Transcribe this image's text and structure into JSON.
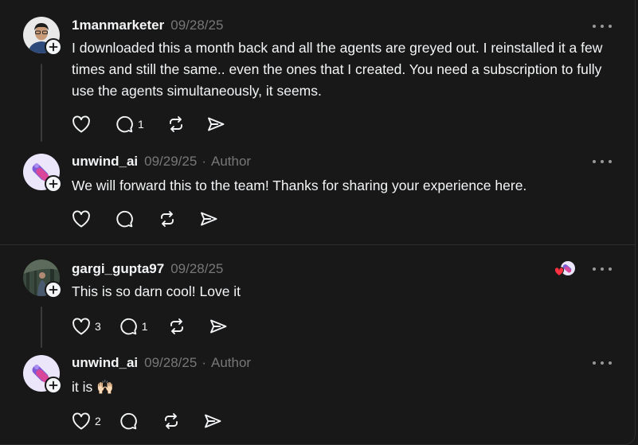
{
  "comments": [
    {
      "username": "1manmarketer",
      "date": "09/28/25",
      "text": "I downloaded this a month back and all the agents are greyed out. I reinstalled it a few times and still the same.. even the ones that I created. You need a subscription to fully use the agents simultaneously, it seems.",
      "likes": "",
      "replies": "1",
      "avatar_icon": "person-photo-avatar",
      "reply": {
        "username": "unwind_ai",
        "date": "09/29/25",
        "author_label": "Author",
        "text": "We will forward this to the team! Thanks for sharing your experience here.",
        "likes": "",
        "replies": "",
        "avatar_icon": "unwind-logo-avatar"
      }
    },
    {
      "username": "gargi_gupta97",
      "date": "09/28/25",
      "text": "This is so darn cool! Love it",
      "likes": "3",
      "replies": "1",
      "avatar_icon": "forest-photo-avatar",
      "liked_by_author": true,
      "reply": {
        "username": "unwind_ai",
        "date": "09/28/25",
        "author_label": "Author",
        "text": "it is 🙌🏻",
        "likes": "2",
        "replies": "",
        "avatar_icon": "unwind-logo-avatar"
      }
    }
  ],
  "colors": {
    "background": "#181818",
    "text": "#f3f5f7",
    "muted": "#777777",
    "liked_heart": "#ff3040",
    "logo_purple": "#7c5cd6"
  },
  "icons": [
    "heart-icon",
    "comment-icon",
    "repost-icon",
    "share-icon",
    "more-icon",
    "follow-plus-icon"
  ]
}
